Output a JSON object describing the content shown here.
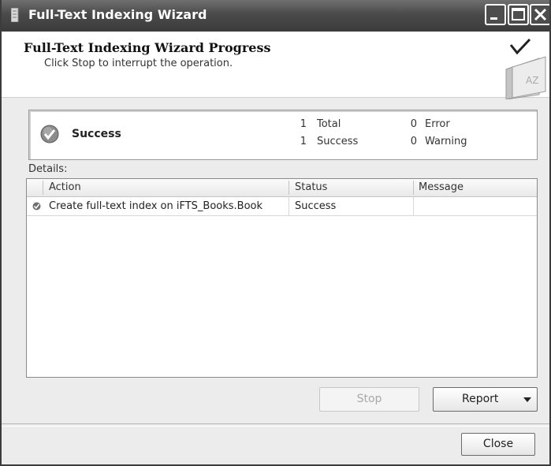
{
  "window": {
    "title": "Full-Text Indexing Wizard"
  },
  "header": {
    "title": "Full-Text Indexing Wizard Progress",
    "subtitle": "Click Stop to interrupt the operation.",
    "icon_text": "AZ"
  },
  "summary": {
    "status": "Success",
    "total_count": "1",
    "total_label": "Total",
    "success_count": "1",
    "success_label": "Success",
    "error_count": "0",
    "error_label": "Error",
    "warning_count": "0",
    "warning_label": "Warning"
  },
  "details": {
    "label": "Details:",
    "columns": [
      "Action",
      "Status",
      "Message"
    ],
    "rows": [
      {
        "action": "Create full-text index on iFTS_Books.Book",
        "status": "Success",
        "message": ""
      }
    ]
  },
  "buttons": {
    "stop": "Stop",
    "report": "Report",
    "close": "Close"
  },
  "colors": {
    "titlebar": "#4a4a4a",
    "window_bg": "#ececec",
    "panel_bg": "#ffffff"
  },
  "icons": {
    "app": "wizard-document-icon",
    "header": "book-az-icon",
    "status": "success-check-icon",
    "report_menu": "dropdown-arrow-icon"
  }
}
